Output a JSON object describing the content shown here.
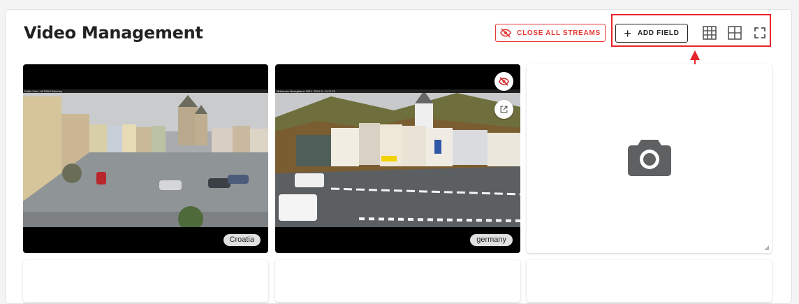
{
  "page": {
    "title": "Video Management"
  },
  "toolbar": {
    "close_all_label": "CLOSE ALL STREAMS",
    "close_all_icon": "eye-off-icon",
    "add_field_label": "ADD FIELD",
    "add_field_icon": "plus-icon",
    "grid_3x3_icon": "grid-3x3-icon",
    "grid_2x2_icon": "grid-2x2-icon",
    "fullscreen_icon": "fullscreen-icon"
  },
  "colors": {
    "danger": "#e53935",
    "annotation": "#e8242b",
    "text": "#212121"
  },
  "streams": [
    {
      "label": "Croatia",
      "overlay_text": "Eddin Osw - #F132b2 Mmbmy"
    },
    {
      "label": "germany",
      "overlay_text": "Mdoeraau Nuwrgfanuc 2024- 2024-11 14:11:23"
    }
  ],
  "empty_tile": {
    "icon": "camera-icon"
  }
}
